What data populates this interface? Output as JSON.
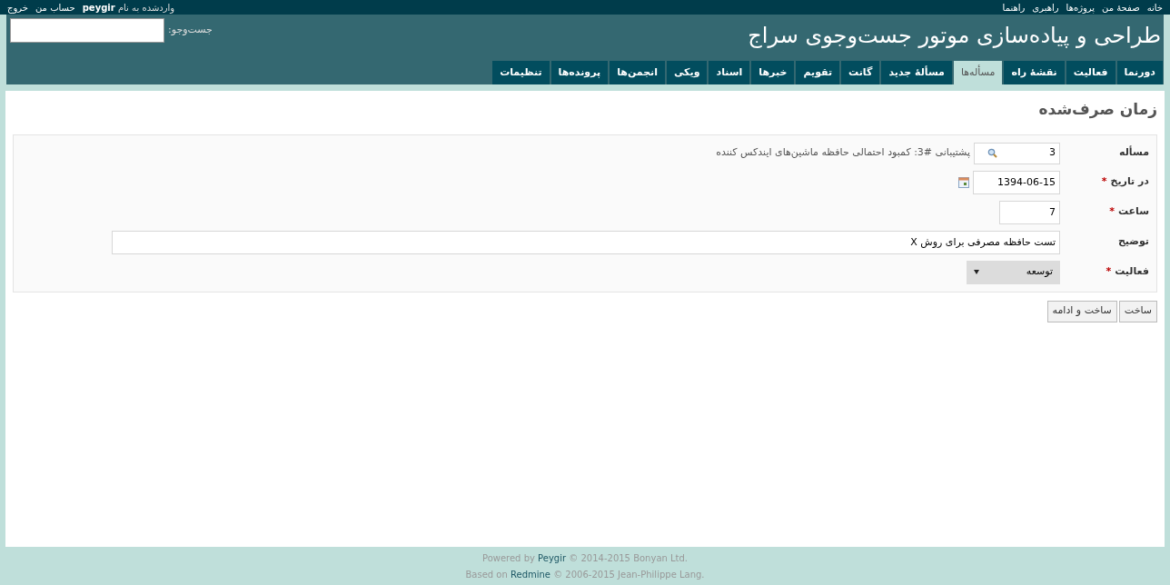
{
  "top_menu": [
    "خانه",
    "صفحهٔ من",
    "پروژه‌ها",
    "راهبری",
    "راهنما"
  ],
  "logged_in": {
    "label": "واردشده به نام",
    "user": "peygir"
  },
  "account_menu": [
    "حساب من",
    "خروج"
  ],
  "header": {
    "title": "طراحی و پیاده‌سازی موتور جست‌وجوی سراج",
    "search_label": "جست‌وجو:"
  },
  "tabs": [
    {
      "label": "دورنما",
      "selected": false
    },
    {
      "label": "فعالیت",
      "selected": false
    },
    {
      "label": "نقشهٔ راه",
      "selected": false
    },
    {
      "label": "مسأله‌ها",
      "selected": true
    },
    {
      "label": "مسألهٔ جدید",
      "selected": false
    },
    {
      "label": "گانت",
      "selected": false
    },
    {
      "label": "تقویم",
      "selected": false
    },
    {
      "label": "خبرها",
      "selected": false
    },
    {
      "label": "اسناد",
      "selected": false
    },
    {
      "label": "ویکی",
      "selected": false
    },
    {
      "label": "انجمن‌ها",
      "selected": false
    },
    {
      "label": "پرونده‌ها",
      "selected": false
    },
    {
      "label": "تنظیمات",
      "selected": false
    }
  ],
  "page_title": "زمان صرف‌شده",
  "fields": [
    {
      "kind": "issue",
      "label": "مسأله",
      "value": "3",
      "note": "پشتیبانی #3: کمبود احتمالی حافظه ماشین‌های ایندکس کننده"
    },
    {
      "kind": "date",
      "label": "در تاریخ",
      "required_mark": "*",
      "value": "1394-06-15"
    },
    {
      "kind": "short",
      "label": "ساعت",
      "required_mark": "*",
      "value": "7"
    },
    {
      "kind": "wide",
      "label": "توضیح",
      "value": "تست حافظه مصرفی برای روش X"
    },
    {
      "kind": "select",
      "label": "فعالیت",
      "required_mark": "*",
      "value": "توسعه"
    }
  ],
  "buttons": [
    "ساخت",
    "ساخت و ادامه"
  ],
  "footer": [
    {
      "prefix": "Powered by",
      "link": "Peygir",
      "suffix": "© 2014-2015 Bonyan Ltd."
    },
    {
      "prefix": "Based on",
      "link": "Redmine",
      "suffix": "© 2006-2015 Jean-Philippe Lang."
    }
  ]
}
